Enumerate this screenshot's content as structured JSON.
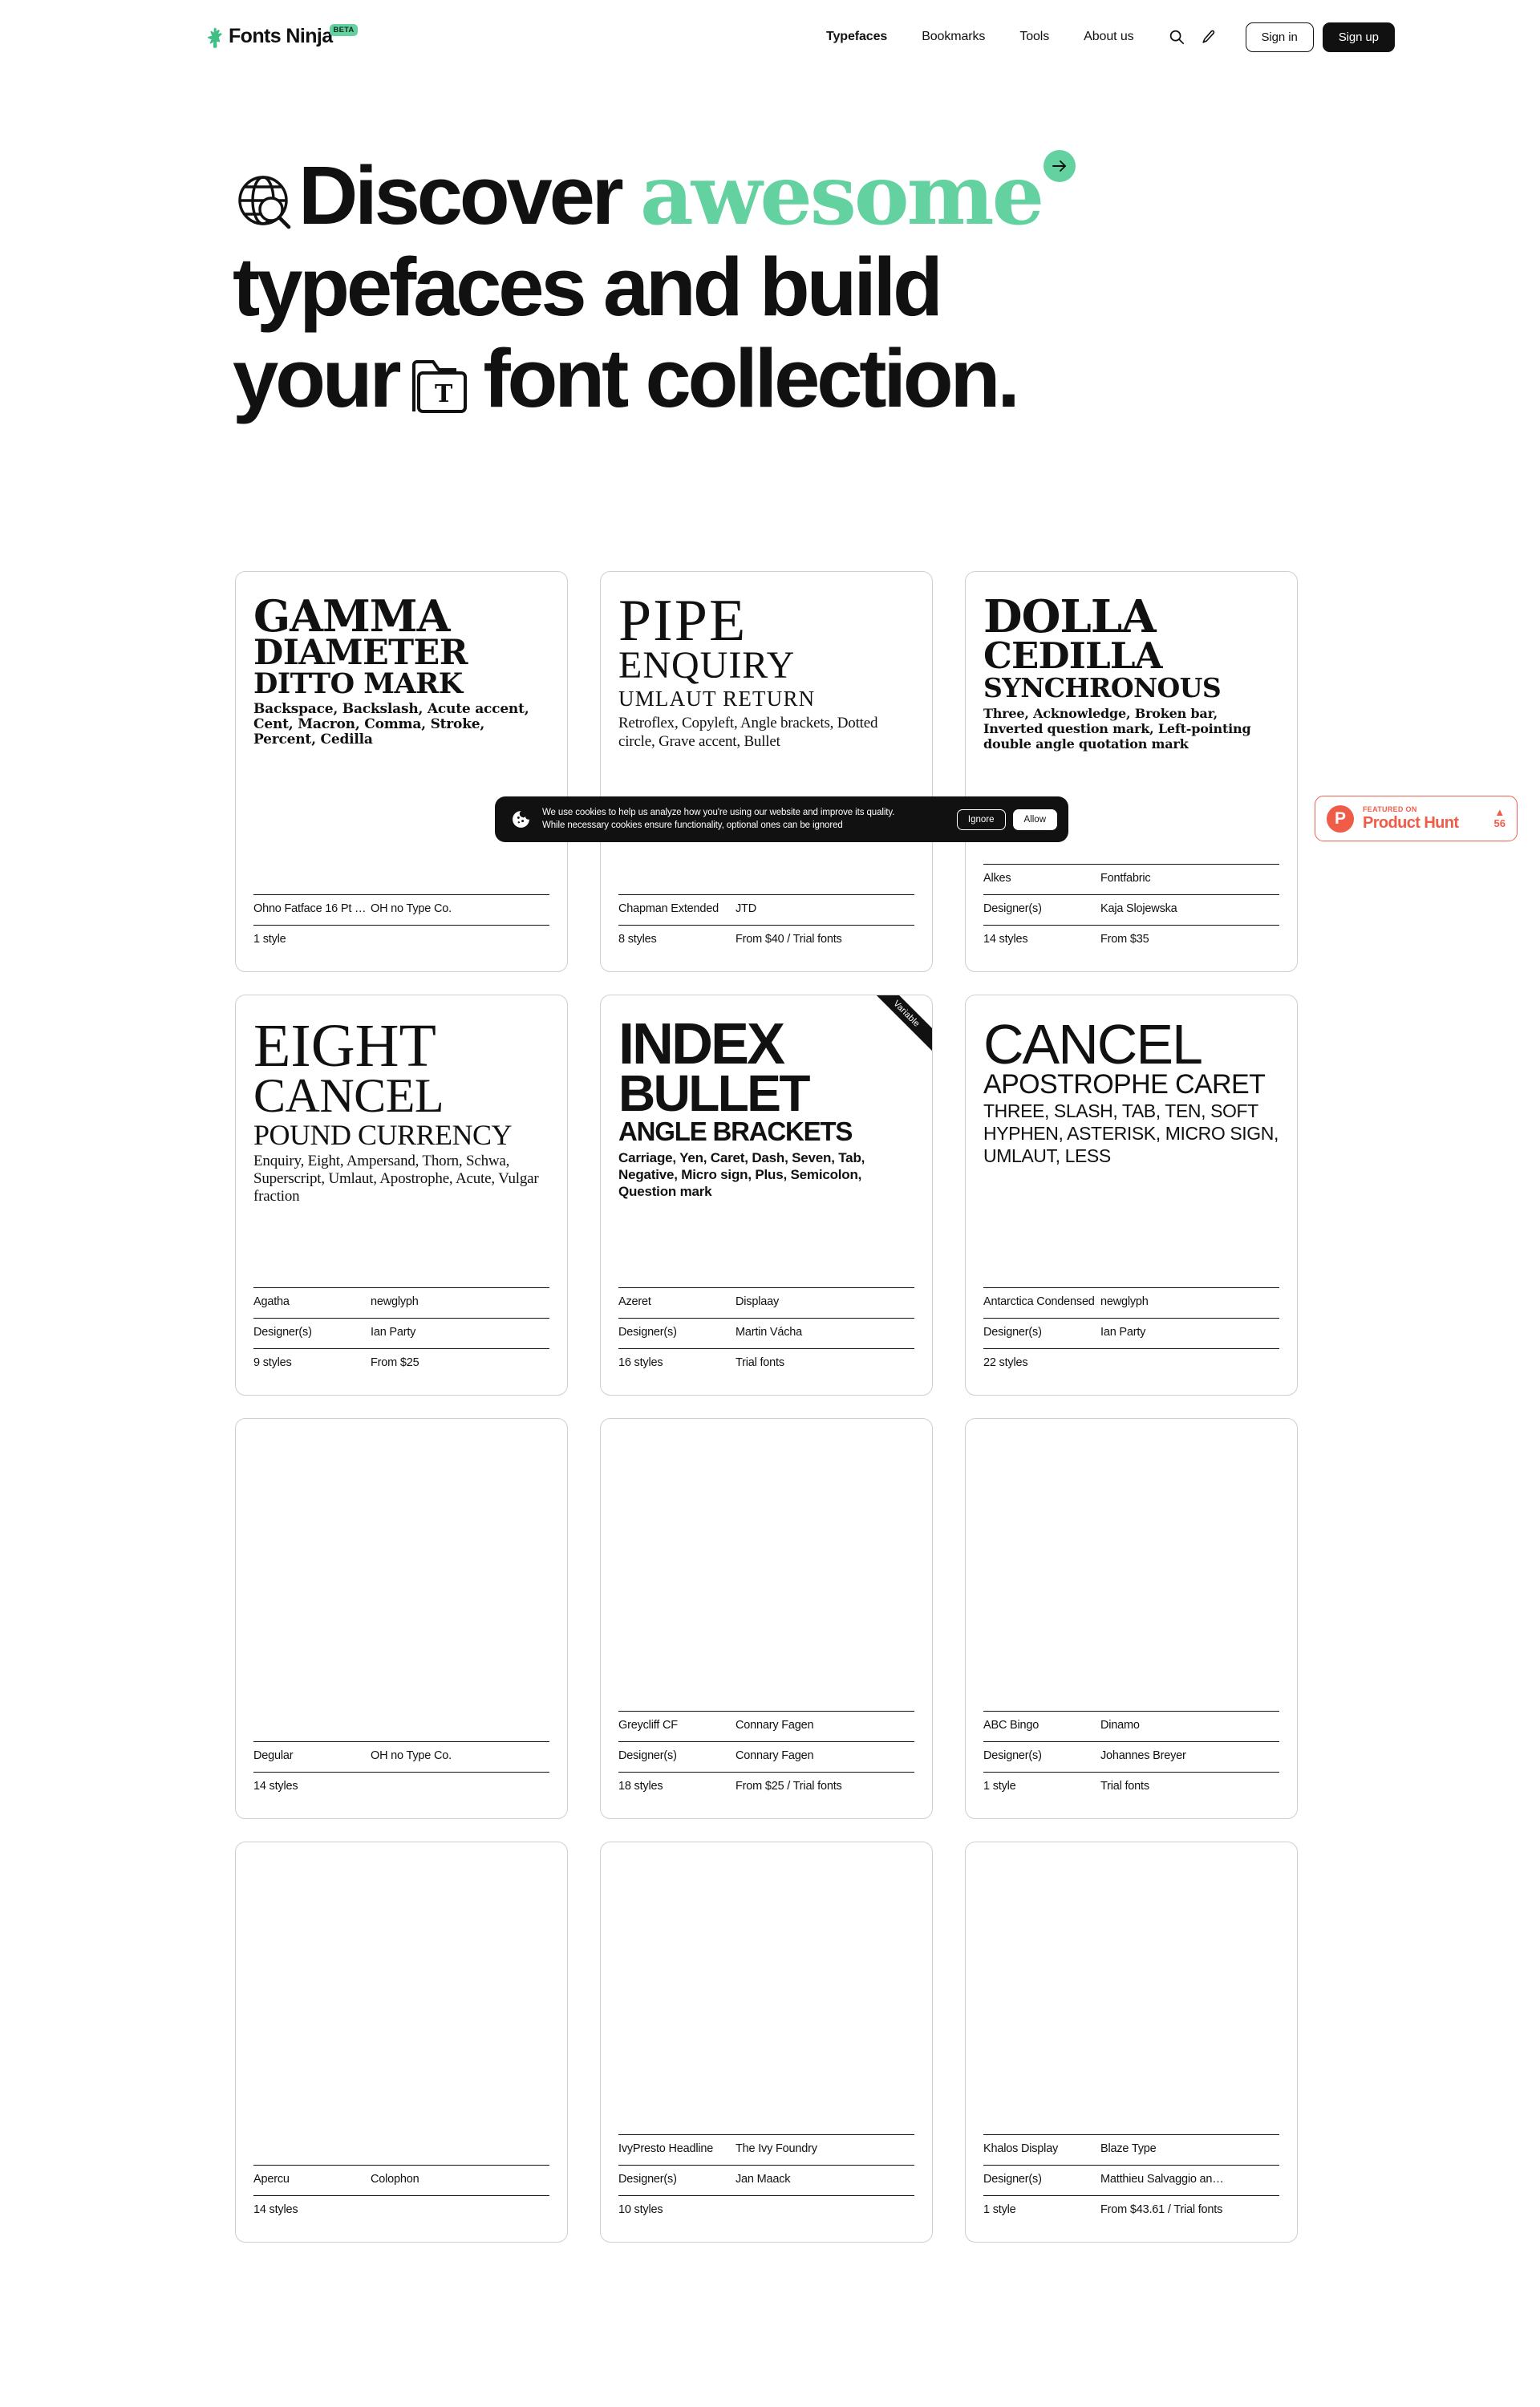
{
  "brand": {
    "name": "Fonts Ninja",
    "badge": "BETA",
    "accent_green": "#63D1A0",
    "ink": "#111111"
  },
  "nav": {
    "links": [
      {
        "label": "Typefaces",
        "active": true
      },
      {
        "label": "Bookmarks",
        "active": false
      },
      {
        "label": "Tools",
        "active": false
      },
      {
        "label": "About us",
        "active": false
      }
    ],
    "icons": [
      {
        "name": "search-icon"
      },
      {
        "name": "pen-icon"
      }
    ],
    "sign_in": "Sign in",
    "sign_up": "Sign up"
  },
  "hero": {
    "line1_a": "Discover",
    "line1_b": "awesome",
    "line2": "typefaces and build",
    "line3_a": "your",
    "line3_b": "font collection."
  },
  "cookie": {
    "line1": "We use cookies to help us analyze how you're using our website and improve its quality.",
    "line2": "While necessary cookies ensure functionality, optional ones can be ignored",
    "ignore": "Ignore",
    "allow": "Allow"
  },
  "product_hunt": {
    "featured": "FEATURED ON",
    "name": "Product Hunt",
    "votes": "56",
    "color": "#EF5C48"
  },
  "cards": [
    {
      "style": "t-fatface",
      "ribbon": null,
      "preview": {
        "l1": "GAMMA",
        "l2": "DIAMETER",
        "l3": "DITTO MARK",
        "l4": "Backspace, Backslash, Acute accent, Cent, Macron, Comma, Stroke, Percent, Cedilla"
      },
      "meta": [
        {
          "k": "Ohno Fatface 16 Pt Na…",
          "v": "OH no Type Co."
        },
        {
          "k": "1 style",
          "v": ""
        }
      ]
    },
    {
      "style": "t-didone",
      "ribbon": null,
      "preview": {
        "l1": "PIPE",
        "l2": "ENQUIRY",
        "l3": "UMLAUT RETURN",
        "l4": "Retroflex, Copyleft, Angle brackets, Dotted circle, Grave accent, Bullet"
      },
      "meta": [
        {
          "k": "Chapman Extended",
          "v": "JTD"
        },
        {
          "k": "8 styles",
          "v": "From $40 / Trial fonts"
        }
      ]
    },
    {
      "style": "t-slab",
      "ribbon": null,
      "preview": {
        "l1": "DOLLA",
        "l2": "CEDILLA",
        "l3": "SYNCHRONOUS",
        "l4": "Three, Acknowledge, Broken bar, Inverted question mark, Left-pointing double angle quotation mark"
      },
      "meta": [
        {
          "k": "Alkes",
          "v": "Fontfabric"
        },
        {
          "k": "Designer(s)",
          "v": "Kaja Slojewska"
        },
        {
          "k": "14 styles",
          "v": "From $35"
        }
      ]
    },
    {
      "style": "t-serifthin",
      "ribbon": null,
      "preview": {
        "l1": "EIGHT",
        "l2": "CANCEL",
        "l3": "POUND CURRENCY",
        "l4": "Enquiry, Eight, Ampersand, Thorn, Schwa, Superscript, Umlaut, Apostrophe, Acute, Vulgar fraction"
      },
      "meta": [
        {
          "k": "Agatha",
          "v": "newglyph"
        },
        {
          "k": "Designer(s)",
          "v": "Ian Party"
        },
        {
          "k": "9 styles",
          "v": "From $25"
        }
      ]
    },
    {
      "style": "t-grotesk",
      "ribbon": "Variable",
      "preview": {
        "l1": "INDEX",
        "l2": "BULLET",
        "l3": "ANGLE BRACKETS",
        "l4": "Carriage, Yen, Caret, Dash, Seven, Tab, Negative, Micro sign, Plus, Semicolon, Question mark"
      },
      "meta": [
        {
          "k": "Azeret",
          "v": "Displaay"
        },
        {
          "k": "Designer(s)",
          "v": "Martin Vácha"
        },
        {
          "k": "16 styles",
          "v": "Trial fonts"
        }
      ]
    },
    {
      "style": "t-light",
      "ribbon": null,
      "preview": {
        "l1": "CANCEL",
        "l2": "APOSTROPHE CARET",
        "l3": "Three, Slash, Tab, Ten, Soft hyphen, Asterisk, Micro sign, Umlaut, Less",
        "l4": ""
      },
      "meta": [
        {
          "k": "Antarctica Condensed",
          "v": "newglyph"
        },
        {
          "k": "Designer(s)",
          "v": "Ian Party"
        },
        {
          "k": "22 styles",
          "v": ""
        }
      ]
    },
    {
      "style": "t-empty",
      "ribbon": null,
      "preview": {
        "l1": "",
        "l2": "",
        "l3": "",
        "l4": ""
      },
      "meta": [
        {
          "k": "Degular",
          "v": "OH no Type Co."
        },
        {
          "k": "14 styles",
          "v": ""
        }
      ]
    },
    {
      "style": "t-empty",
      "ribbon": null,
      "preview": {
        "l1": "",
        "l2": "",
        "l3": "",
        "l4": ""
      },
      "meta": [
        {
          "k": "Greycliff CF",
          "v": "Connary Fagen"
        },
        {
          "k": "Designer(s)",
          "v": "Connary Fagen"
        },
        {
          "k": "18 styles",
          "v": "From $25 / Trial fonts"
        }
      ]
    },
    {
      "style": "t-empty",
      "ribbon": null,
      "preview": {
        "l1": "",
        "l2": "",
        "l3": "",
        "l4": ""
      },
      "meta": [
        {
          "k": "ABC Bingo",
          "v": "Dinamo"
        },
        {
          "k": "Designer(s)",
          "v": "Johannes Breyer"
        },
        {
          "k": "1 style",
          "v": "Trial fonts"
        }
      ]
    },
    {
      "style": "t-empty",
      "ribbon": null,
      "preview": {
        "l1": "",
        "l2": "",
        "l3": "",
        "l4": ""
      },
      "meta": [
        {
          "k": "Apercu",
          "v": "Colophon"
        },
        {
          "k": "14 styles",
          "v": ""
        }
      ]
    },
    {
      "style": "t-empty",
      "ribbon": null,
      "preview": {
        "l1": "",
        "l2": "",
        "l3": "",
        "l4": ""
      },
      "meta": [
        {
          "k": "IvyPresto Headline",
          "v": "The Ivy Foundry"
        },
        {
          "k": "Designer(s)",
          "v": "Jan Maack"
        },
        {
          "k": "10 styles",
          "v": ""
        }
      ]
    },
    {
      "style": "t-empty",
      "ribbon": null,
      "preview": {
        "l1": "",
        "l2": "",
        "l3": "",
        "l4": ""
      },
      "meta": [
        {
          "k": "Khalos Display",
          "v": "Blaze Type"
        },
        {
          "k": "Designer(s)",
          "v": "Matthieu Salvaggio an…"
        },
        {
          "k": "1 style",
          "v": "From $43.61 / Trial fonts"
        }
      ]
    }
  ]
}
